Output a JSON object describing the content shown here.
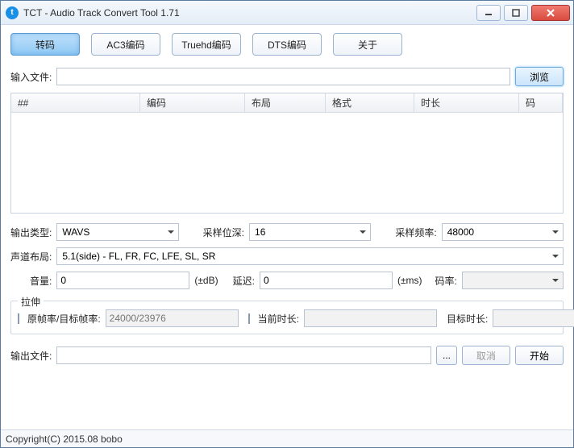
{
  "window": {
    "title": "TCT - Audio Track Convert Tool 1.71"
  },
  "tabs": {
    "convert": "转码",
    "ac3": "AC3编码",
    "truehd": "Truehd编码",
    "dts": "DTS编码",
    "about": "关于"
  },
  "labels": {
    "input_file": "输入文件:",
    "browse": "浏览",
    "output_type": "输出类型:",
    "sample_depth": "采样位深:",
    "sample_rate": "采样频率:",
    "channel_layout": "声道布局:",
    "volume": "音量:",
    "db_unit": "(±dB)",
    "delay": "延迟:",
    "ms_unit": "(±ms)",
    "bitrate": "码率:",
    "stretch": "拉伸",
    "fps_ratio": "原帧率/目标帧率:",
    "current_duration": "当前时长:",
    "target_duration": "目标时长:",
    "output_file": "输出文件:",
    "cancel": "取消",
    "start": "开始"
  },
  "columns": {
    "num": "##",
    "codec": "编码",
    "layout": "布局",
    "format": "格式",
    "duration": "时长",
    "bitrate": "码"
  },
  "values": {
    "input_file": "",
    "output_type": "WAVS",
    "sample_depth": "16",
    "sample_rate": "48000",
    "channel_layout": "5.1(side) - FL, FR, FC, LFE, SL, SR",
    "volume": "0",
    "delay": "0",
    "bitrate": "",
    "fps_ratio_placeholder": "24000/23976",
    "current_duration": "",
    "target_duration": "",
    "output_file": ""
  },
  "status": "Copyright(C) 2015.08 bobo"
}
